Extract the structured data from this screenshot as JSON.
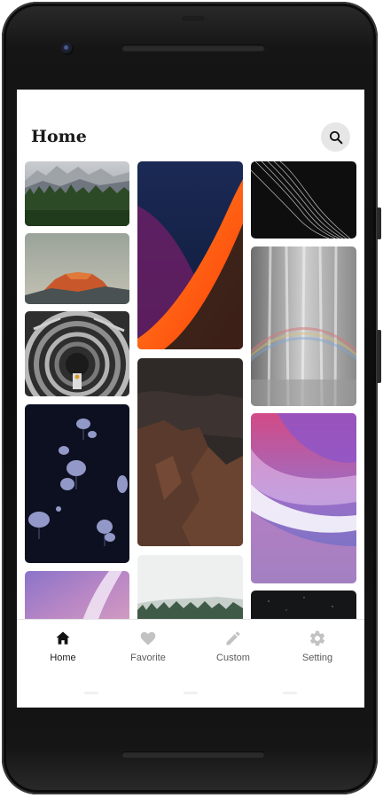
{
  "app": {
    "title": "Home"
  },
  "search": {
    "icon": "search-icon"
  },
  "nav": {
    "items": [
      {
        "label": "Home",
        "icon": "home-icon",
        "active": true
      },
      {
        "label": "Favorite",
        "icon": "heart-icon",
        "active": false
      },
      {
        "label": "Custom",
        "icon": "pencil-icon",
        "active": false
      },
      {
        "label": "Setting",
        "icon": "gear-icon",
        "active": false
      }
    ]
  },
  "wallpapers": [
    {
      "subject": "mountain-forest"
    },
    {
      "subject": "half-dome-sunset"
    },
    {
      "subject": "spiral-maze"
    },
    {
      "subject": "jellyfish"
    },
    {
      "subject": "purple-waves-small"
    },
    {
      "subject": "orange-abstract-curve"
    },
    {
      "subject": "canyon-rocks"
    },
    {
      "subject": "misty-forest"
    },
    {
      "subject": "dark-wave-lines"
    },
    {
      "subject": "waterfall-rainbow"
    },
    {
      "subject": "pink-purple-waves"
    },
    {
      "subject": "dark-sky"
    }
  ],
  "colors": {
    "accent": "#1a1a1a",
    "nav_inactive": "#bdbdbd",
    "frame": "#111111"
  }
}
